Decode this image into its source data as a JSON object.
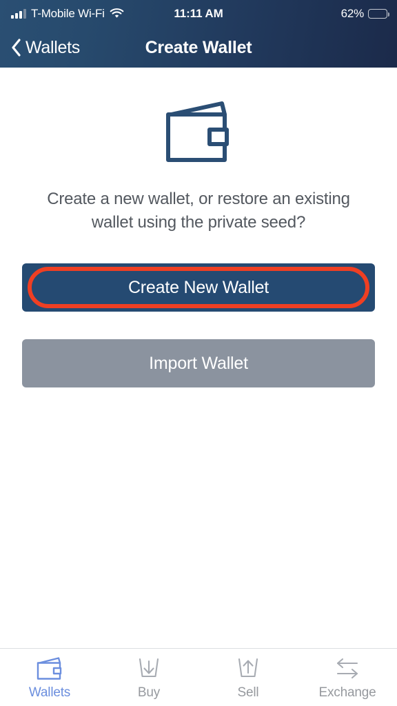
{
  "status_bar": {
    "carrier": "T-Mobile Wi-Fi",
    "signal_icon": "signal-bars-icon",
    "wifi_icon": "wifi-icon",
    "time": "11:11 AM",
    "battery_percent": "62%",
    "battery_icon": "battery-icon",
    "battery_level": 62
  },
  "nav_bar": {
    "back_icon": "chevron-left-icon",
    "back_label": "Wallets",
    "title": "Create Wallet"
  },
  "main": {
    "hero_icon": "wallet-icon",
    "description": "Create a new wallet, or restore an existing wallet using the private seed?",
    "primary_button": {
      "label": "Create New Wallet",
      "color": "#254a72",
      "highlighted": true,
      "highlight_color": "#ef3f23"
    },
    "secondary_button": {
      "label": "Import Wallet",
      "color": "#8b939f"
    }
  },
  "tab_bar": {
    "active_color": "#6b8ede",
    "inactive_color": "#96999e",
    "items": [
      {
        "label": "Wallets",
        "icon": "wallet-icon",
        "active": true
      },
      {
        "label": "Buy",
        "icon": "tray-arrow-down-icon",
        "active": false
      },
      {
        "label": "Sell",
        "icon": "tray-arrow-up-icon",
        "active": false
      },
      {
        "label": "Exchange",
        "icon": "exchange-arrows-icon",
        "active": false
      }
    ]
  },
  "theme": {
    "header_gradient_start": "#2a4f73",
    "header_gradient_end": "#1b2a4a",
    "brand_navy": "#254a72",
    "text_gray": "#53585f"
  }
}
